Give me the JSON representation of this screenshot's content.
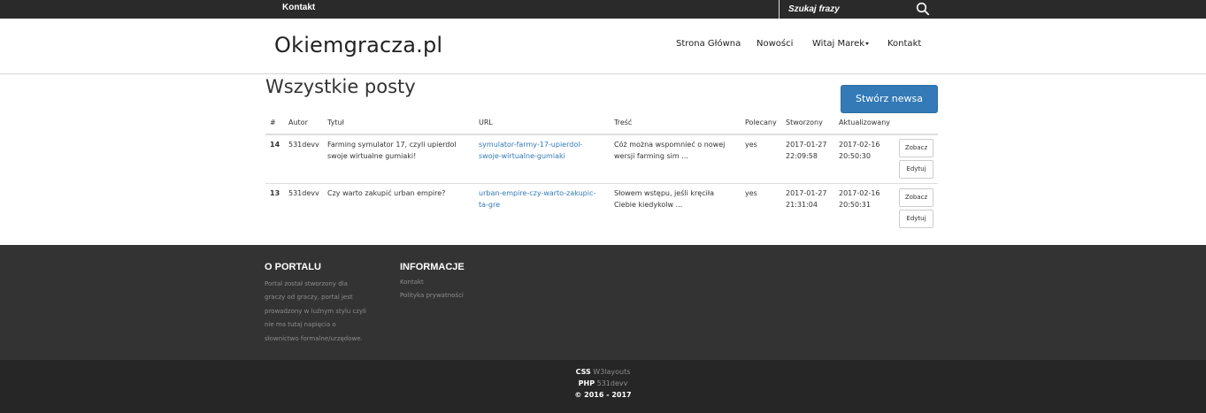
{
  "topbar": {
    "contact_label": "Kontakt",
    "search_placeholder": "Szukaj frazy",
    "search_icon": "search-icon"
  },
  "header": {
    "brand": "Okiemgracza.pl",
    "nav": {
      "home": "Strona Główna",
      "news": "Nowości",
      "user": "Witaj Marek",
      "contact": "Kontakt"
    }
  },
  "main": {
    "title": "Wszystkie posty",
    "create_button": "Stwórz newsa",
    "table": {
      "headers": {
        "id": "#",
        "author": "Autor",
        "title": "Tytuł",
        "url": "URL",
        "content": "Treść",
        "featured": "Polecany",
        "created": "Stworzony",
        "updated": "Aktualizowany"
      },
      "rows": [
        {
          "id": "14",
          "author": "531devv",
          "title_1": "Farming symulator 17, czyli upierdol",
          "title_2": "swoje wirtualne gumiaki!",
          "url_1": "symulator-farmy-17-upierdol-",
          "url_2": "swoje-wirtualne-gumiaki",
          "content_1": "Cóż można wspomnieć o nowej",
          "content_2": "wersji farming sim ...",
          "featured": "yes",
          "created_date": "2017-01-27",
          "created_time": "22:09:58",
          "updated_date": "2017-02-16",
          "updated_time": "20:50:30",
          "view_label": "Zobacz",
          "edit_label": "Edytuj"
        },
        {
          "id": "13",
          "author": "531devv",
          "title_1": "Czy warto zakupić urban empire?",
          "title_2": "",
          "url_1": "urban-empire-czy-warto-zakupic-",
          "url_2": "ta-gre",
          "content_1": "Słowem wstępu, jeśli kręciła",
          "content_2": "Ciebie kiedykolw ...",
          "featured": "yes",
          "created_date": "2017-01-27",
          "created_time": "21:31:04",
          "updated_date": "2017-02-16",
          "updated_time": "20:50:31",
          "view_label": "Zobacz",
          "edit_label": "Edytuj"
        }
      ]
    }
  },
  "footer": {
    "about": {
      "heading": "O PORTALU",
      "lines": [
        "Portal został stworzony dla",
        "graczy od graczy, portal jest",
        "prowadzony w luźnym stylu czyli",
        "nie ma tutaj napięcia o",
        "słownictwo formalne/urzędowe."
      ]
    },
    "info": {
      "heading": "INFORMACJE",
      "links": [
        "Kontakt",
        "Polityka prywatności"
      ]
    },
    "credits": {
      "css_label": "CSS",
      "css_value": "W3layouts",
      "php_label": "PHP",
      "php_value": "531devv",
      "copyright": "© 2016 - 2017"
    }
  },
  "colors": {
    "topbar_bg": "#2a2a2a",
    "primary": "#337ab7",
    "footer_bg": "#333333",
    "bottom_bg": "#262626"
  }
}
